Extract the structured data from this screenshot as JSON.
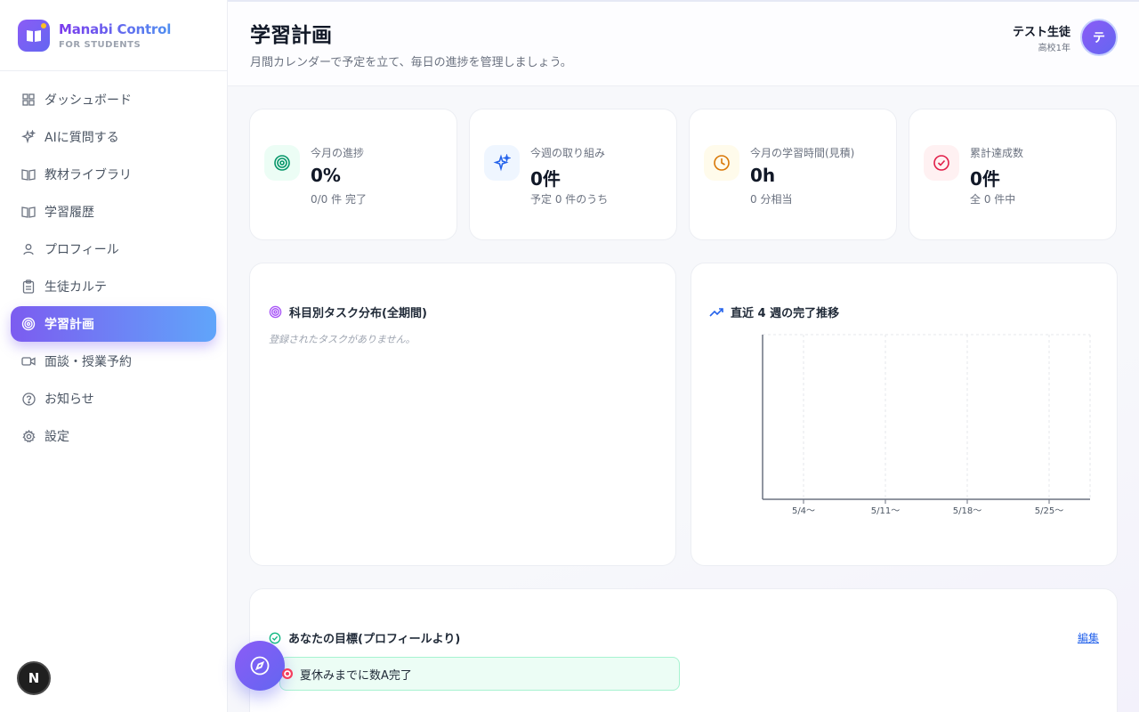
{
  "brand": {
    "title": "Manabi Control",
    "subtitle": "FOR STUDENTS"
  },
  "sidebar": {
    "items": [
      {
        "label": "ダッシュボード",
        "icon": "grid-icon"
      },
      {
        "label": "AIに質問する",
        "icon": "sparkles-icon"
      },
      {
        "label": "教材ライブラリ",
        "icon": "book-open-icon"
      },
      {
        "label": "学習履歴",
        "icon": "book-open-icon"
      },
      {
        "label": "プロフィール",
        "icon": "user-icon"
      },
      {
        "label": "生徒カルテ",
        "icon": "clipboard-icon"
      },
      {
        "label": "学習計画",
        "icon": "target-icon",
        "active": true
      },
      {
        "label": "面談・授業予約",
        "icon": "video-icon"
      },
      {
        "label": "お知らせ",
        "icon": "help-circle-icon"
      },
      {
        "label": "設定",
        "icon": "gear-icon"
      }
    ]
  },
  "header": {
    "title": "学習計画",
    "subtitle": "月間カレンダーで予定を立て、毎日の進捗を管理しましょう。",
    "user_name": "テスト生徒",
    "user_grade": "高校1年",
    "avatar_initial": "テ"
  },
  "stats": [
    {
      "label": "今月の進捗",
      "value": "0%",
      "note": "0/0 件 完了",
      "icon": "target-icon",
      "color": "#059669",
      "bg": "#ecfdf5"
    },
    {
      "label": "今週の取り組み",
      "value": "0件",
      "note": "予定 0 件のうち",
      "icon": "sparkles-icon",
      "color": "#2563eb",
      "bg": "#eff6ff"
    },
    {
      "label": "今月の学習時間(見積)",
      "value": "0h",
      "note": "0 分相当",
      "icon": "clock-icon",
      "color": "#d97706",
      "bg": "#fffbeb"
    },
    {
      "label": "累計達成数",
      "value": "0件",
      "note": "全 0 件中",
      "icon": "check-circle-icon",
      "color": "#e11d48",
      "bg": "#fff1f2"
    }
  ],
  "subject_panel": {
    "title": "科目別タスク分布(全期間)",
    "empty_message": "登録されたタスクがありません。"
  },
  "trend_panel": {
    "title": "直近 4 週の完了推移"
  },
  "chart_data": {
    "type": "line",
    "categories": [
      "5/4〜",
      "5/11〜",
      "5/18〜",
      "5/25〜"
    ],
    "series": [],
    "title": "直近 4 週の完了推移",
    "xlabel": "",
    "ylabel": "",
    "grid": true
  },
  "goals_panel": {
    "title": "あなたの目標(プロフィールより)",
    "edit_label": "編集",
    "goal_text": "夏休みまでに数A完了"
  },
  "colors": {
    "accent": "#7c5cf0",
    "accent_end": "#60a5fa"
  }
}
